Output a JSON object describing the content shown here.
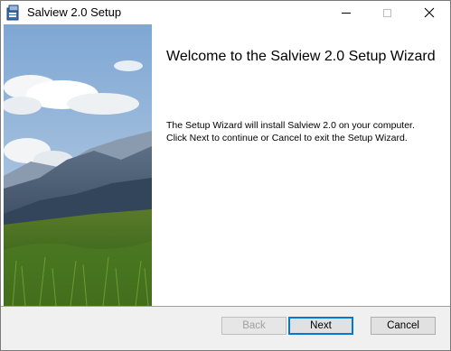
{
  "window": {
    "title": "Salview 2.0 Setup",
    "controls": {
      "minimize_icon": "minimize-icon",
      "maximize_icon": "maximize-icon",
      "close_icon": "close-icon"
    }
  },
  "banner": {
    "image": "mountain-meadow-sky-image"
  },
  "wizard": {
    "heading": "Welcome to the Salview 2.0 Setup Wizard",
    "description_line1": "The Setup Wizard will install Salview 2.0 on your computer.",
    "description_line2": "Click Next to continue or Cancel to exit the Setup Wizard."
  },
  "buttons": {
    "back_label": "Back",
    "back_enabled": false,
    "next_label": "Next",
    "cancel_label": "Cancel"
  },
  "colors": {
    "accent": "#0078d7",
    "dialog_bg": "#f0f0f0",
    "disabled_text": "#a0a0a0"
  }
}
